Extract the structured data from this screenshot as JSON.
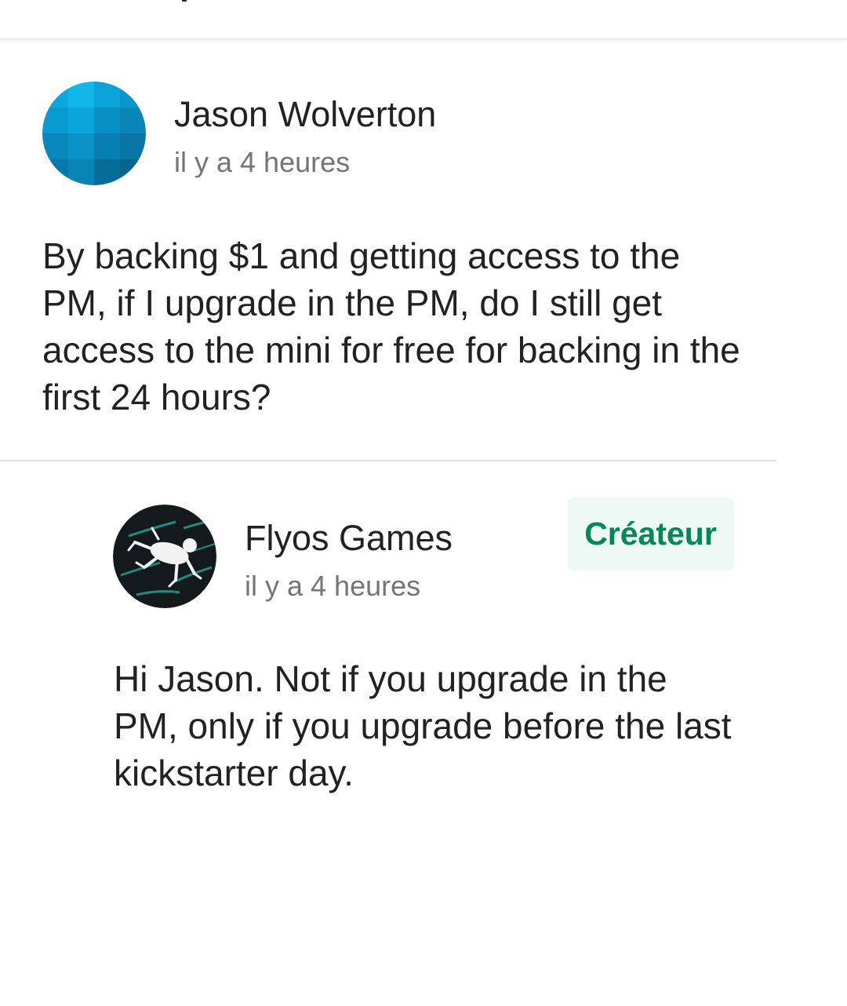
{
  "colors": {
    "badge_bg": "#eef8f4",
    "badge_text": "#028858",
    "secondary_text": "#757575"
  },
  "comment": {
    "author": "Jason Wolverton",
    "time": "il y a 4 heures",
    "text": "By backing $1 and getting access to the PM, if I upgrade in the PM, do I still get access to the mini for free for backing in the first 24 hours?",
    "avatar_icon": "geometric-avatar-icon"
  },
  "reply": {
    "author": "Flyos Games",
    "badge": "Créateur",
    "time": "il y a 4 heures",
    "text": "Hi Jason. Not if you upgrade in the PM, only if you upgrade before the last kickstarter day.",
    "avatar_icon": "frog-logo-icon"
  }
}
